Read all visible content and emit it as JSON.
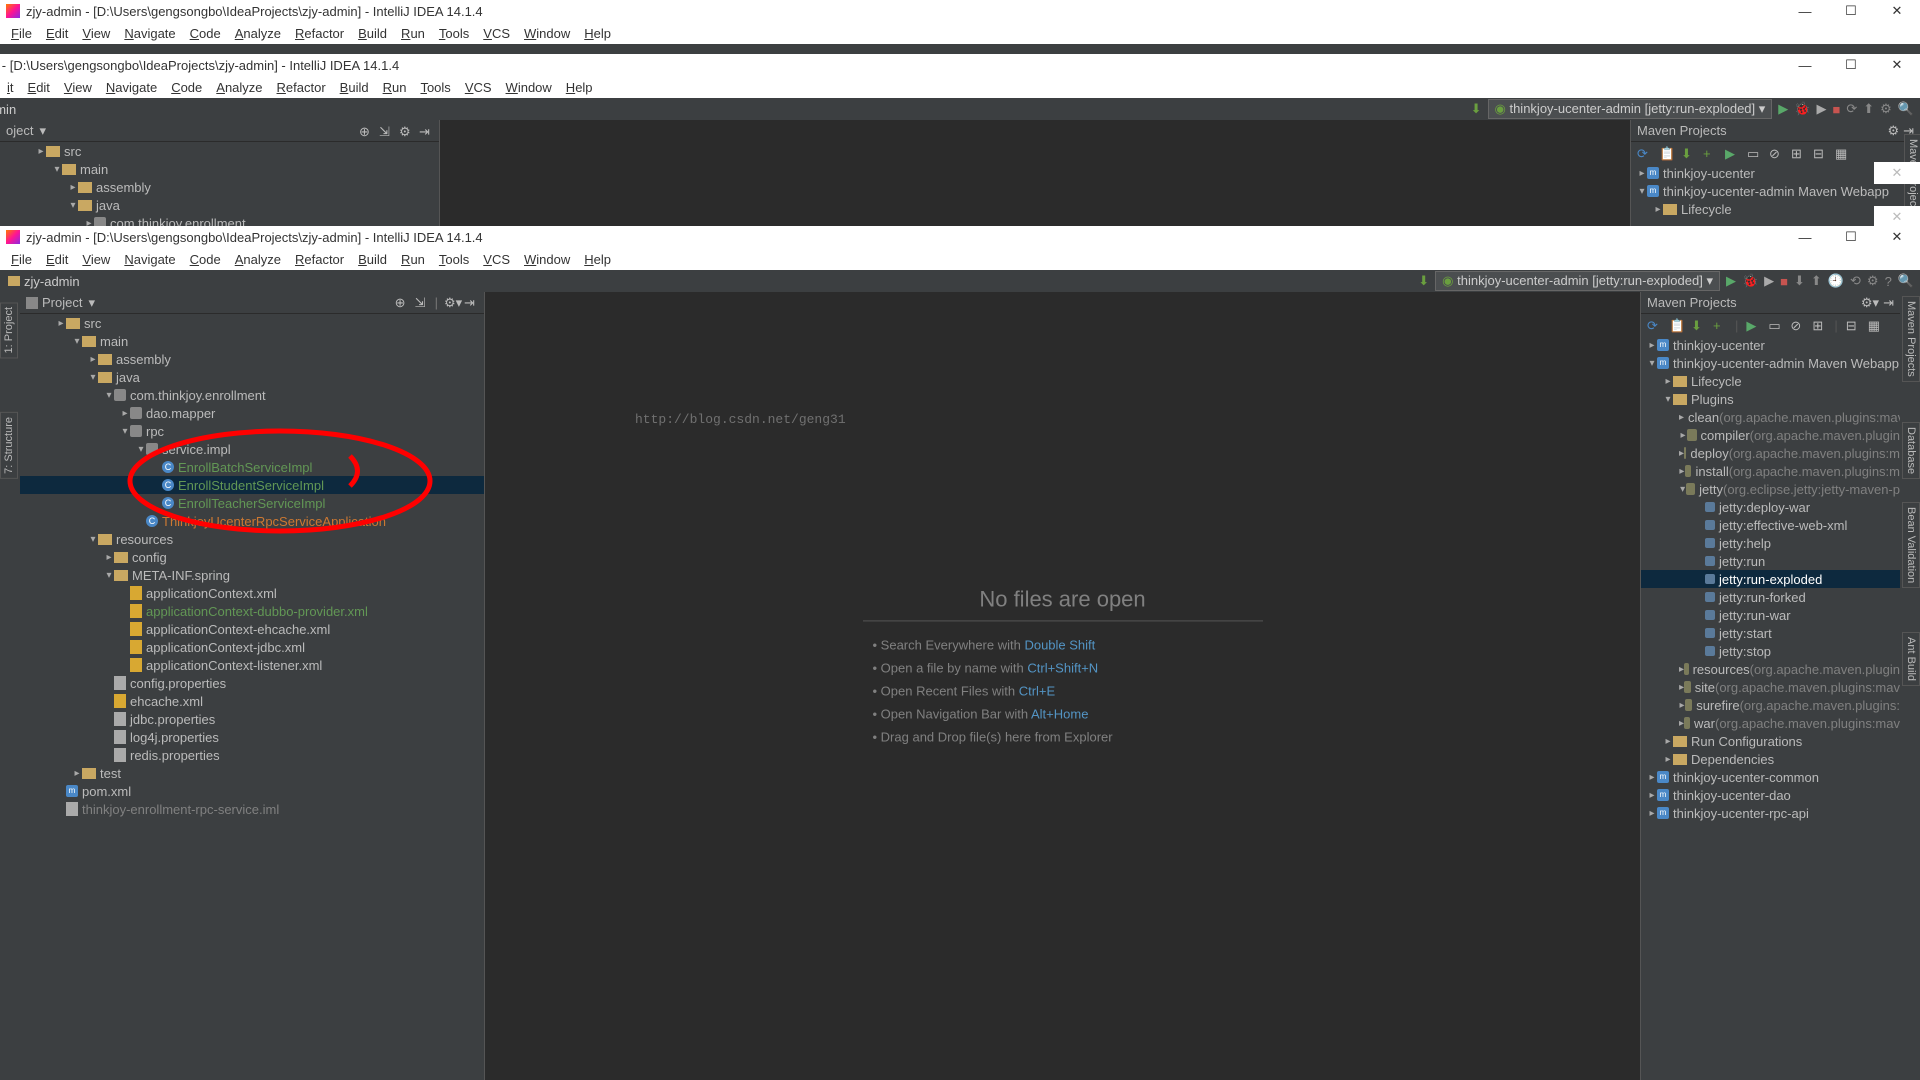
{
  "title": "zjy-admin - [D:\\Users\\gengsongbo\\IdeaProjects\\zjy-admin] - IntelliJ IDEA 14.1.4",
  "menu": [
    "File",
    "Edit",
    "View",
    "Navigate",
    "Code",
    "Analyze",
    "Refactor",
    "Build",
    "Run",
    "Tools",
    "VCS",
    "Window",
    "Help"
  ],
  "breadcrumb_root": "zjy-admin",
  "run_config": "thinkjoy-ucenter-admin [jetty:run-exploded]",
  "project_panel": "Project",
  "panel_icons": [
    "scroll",
    "collapse",
    "settings",
    "hide"
  ],
  "watermark_url": "http://blog.csdn.net/geng31",
  "no_files": "No files are open",
  "tips": [
    {
      "t": "Search Everywhere with ",
      "k": "Double Shift"
    },
    {
      "t": "Open a file by name with ",
      "k": "Ctrl+Shift+N"
    },
    {
      "t": "Open Recent Files with ",
      "k": "Ctrl+E"
    },
    {
      "t": "Open Navigation Bar with ",
      "k": "Alt+Home"
    },
    {
      "t": "Drag and Drop file(s) here from Explorer",
      "k": ""
    }
  ],
  "tree_w2": [
    {
      "d": 2,
      "a": "▸",
      "i": "fld",
      "t": "src"
    },
    {
      "d": 3,
      "a": "▾",
      "i": "fld",
      "t": "main"
    },
    {
      "d": 4,
      "a": "▸",
      "i": "fld",
      "t": "assembly"
    },
    {
      "d": 4,
      "a": "▾",
      "i": "fld",
      "t": "java"
    },
    {
      "d": 5,
      "a": "▸",
      "i": "pkg",
      "t": "com.thinkjoy.enrollment"
    }
  ],
  "tree_w3": [
    {
      "d": 2,
      "a": "▸",
      "i": "fld",
      "t": "src"
    },
    {
      "d": 3,
      "a": "▾",
      "i": "fld",
      "t": "main"
    },
    {
      "d": 4,
      "a": "▸",
      "i": "fld",
      "t": "assembly"
    },
    {
      "d": 4,
      "a": "▾",
      "i": "fld",
      "t": "java"
    },
    {
      "d": 5,
      "a": "▾",
      "i": "pkg",
      "t": "com.thinkjoy.enrollment"
    },
    {
      "d": 6,
      "a": "▸",
      "i": "pkg",
      "t": "dao.mapper"
    },
    {
      "d": 6,
      "a": "▾",
      "i": "pkg",
      "t": "rpc"
    },
    {
      "d": 7,
      "a": "▾",
      "i": "pkg",
      "t": "service.impl"
    },
    {
      "d": 8,
      "a": "",
      "i": "cls",
      "t": "EnrollBatchServiceImpl",
      "cls": "green-txt"
    },
    {
      "d": 8,
      "a": "",
      "i": "cls",
      "t": "EnrollStudentServiceImpl",
      "cls": "green-txt",
      "sel": true
    },
    {
      "d": 8,
      "a": "",
      "i": "cls",
      "t": "EnrollTeacherServiceImpl",
      "cls": "green-txt"
    },
    {
      "d": 7,
      "a": "",
      "i": "cls",
      "t": "ThinkjoyUcenterRpcServiceApplication",
      "cls": "orange-txt"
    },
    {
      "d": 4,
      "a": "▾",
      "i": "fld",
      "t": "resources"
    },
    {
      "d": 5,
      "a": "▸",
      "i": "fld",
      "t": "config"
    },
    {
      "d": 5,
      "a": "▾",
      "i": "fld",
      "t": "META-INF.spring"
    },
    {
      "d": 6,
      "a": "",
      "i": "xml",
      "t": "applicationContext.xml"
    },
    {
      "d": 6,
      "a": "",
      "i": "xml",
      "t": "applicationContext-dubbo-provider.xml",
      "cls": "green-txt"
    },
    {
      "d": 6,
      "a": "",
      "i": "xml",
      "t": "applicationContext-ehcache.xml"
    },
    {
      "d": 6,
      "a": "",
      "i": "xml",
      "t": "applicationContext-jdbc.xml"
    },
    {
      "d": 6,
      "a": "",
      "i": "xml",
      "t": "applicationContext-listener.xml"
    },
    {
      "d": 5,
      "a": "",
      "i": "file",
      "t": "config.properties"
    },
    {
      "d": 5,
      "a": "",
      "i": "xml",
      "t": "ehcache.xml"
    },
    {
      "d": 5,
      "a": "",
      "i": "file",
      "t": "jdbc.properties"
    },
    {
      "d": 5,
      "a": "",
      "i": "file",
      "t": "log4j.properties"
    },
    {
      "d": 5,
      "a": "",
      "i": "file",
      "t": "redis.properties"
    },
    {
      "d": 3,
      "a": "▸",
      "i": "fld",
      "t": "test"
    },
    {
      "d": 2,
      "a": "",
      "i": "m",
      "t": "pom.xml"
    },
    {
      "d": 2,
      "a": "",
      "i": "file",
      "t": "thinkjoy-enrollment-rpc-service.iml",
      "cls": "dim"
    }
  ],
  "maven_title": "Maven Projects",
  "maven_w2": [
    {
      "d": 0,
      "a": "▸",
      "i": "m",
      "t": "thinkjoy-ucenter"
    },
    {
      "d": 0,
      "a": "▾",
      "i": "m",
      "t": "thinkjoy-ucenter-admin Maven Webapp"
    },
    {
      "d": 1,
      "a": "▸",
      "i": "fld",
      "t": "Lifecycle"
    }
  ],
  "maven_w3": [
    {
      "d": 0,
      "a": "▸",
      "i": "m",
      "t": "thinkjoy-ucenter"
    },
    {
      "d": 0,
      "a": "▾",
      "i": "m",
      "t": "thinkjoy-ucenter-admin Maven Webapp"
    },
    {
      "d": 1,
      "a": "▸",
      "i": "fld",
      "t": "Lifecycle"
    },
    {
      "d": 1,
      "a": "▾",
      "i": "fld",
      "t": "Plugins"
    },
    {
      "d": 2,
      "a": "▸",
      "i": "g",
      "t": "clean",
      "x": "(org.apache.maven.plugins:mav"
    },
    {
      "d": 2,
      "a": "▸",
      "i": "g",
      "t": "compiler",
      "x": "(org.apache.maven.plugin"
    },
    {
      "d": 2,
      "a": "▸",
      "i": "g",
      "t": "deploy",
      "x": "(org.apache.maven.plugins:m"
    },
    {
      "d": 2,
      "a": "▸",
      "i": "g",
      "t": "install",
      "x": "(org.apache.maven.plugins:m"
    },
    {
      "d": 2,
      "a": "▾",
      "i": "g",
      "t": "jetty",
      "x": "(org.eclipse.jetty:jetty-maven-p"
    },
    {
      "d": 3,
      "a": "",
      "i": "goal",
      "t": "jetty:deploy-war"
    },
    {
      "d": 3,
      "a": "",
      "i": "goal",
      "t": "jetty:effective-web-xml"
    },
    {
      "d": 3,
      "a": "",
      "i": "goal",
      "t": "jetty:help"
    },
    {
      "d": 3,
      "a": "",
      "i": "goal",
      "t": "jetty:run"
    },
    {
      "d": 3,
      "a": "",
      "i": "goal",
      "t": "jetty:run-exploded",
      "sel": true
    },
    {
      "d": 3,
      "a": "",
      "i": "goal",
      "t": "jetty:run-forked"
    },
    {
      "d": 3,
      "a": "",
      "i": "goal",
      "t": "jetty:run-war"
    },
    {
      "d": 3,
      "a": "",
      "i": "goal",
      "t": "jetty:start"
    },
    {
      "d": 3,
      "a": "",
      "i": "goal",
      "t": "jetty:stop"
    },
    {
      "d": 2,
      "a": "▸",
      "i": "g",
      "t": "resources",
      "x": "(org.apache.maven.plugin"
    },
    {
      "d": 2,
      "a": "▸",
      "i": "g",
      "t": "site",
      "x": "(org.apache.maven.plugins:mav"
    },
    {
      "d": 2,
      "a": "▸",
      "i": "g",
      "t": "surefire",
      "x": "(org.apache.maven.plugins:"
    },
    {
      "d": 2,
      "a": "▸",
      "i": "g",
      "t": "war",
      "x": "(org.apache.maven.plugins:mav"
    },
    {
      "d": 1,
      "a": "▸",
      "i": "fld",
      "t": "Run Configurations"
    },
    {
      "d": 1,
      "a": "▸",
      "i": "fld",
      "t": "Dependencies"
    },
    {
      "d": 0,
      "a": "▸",
      "i": "m",
      "t": "thinkjoy-ucenter-common"
    },
    {
      "d": 0,
      "a": "▸",
      "i": "m",
      "t": "thinkjoy-ucenter-dao"
    },
    {
      "d": 0,
      "a": "▸",
      "i": "m",
      "t": "thinkjoy-ucenter-rpc-api"
    }
  ],
  "side_tabs_right": [
    "Maven Projects",
    "Database",
    "Bean Validation",
    "Ant Build"
  ],
  "side_tabs_left": [
    "1: Project",
    "7: Structure"
  ],
  "toolbar_icons": [
    "build",
    "run",
    "debug",
    "coverage",
    "stop",
    "vcs-update",
    "vcs-commit",
    "vcs-history",
    "vcs-revert",
    "settings",
    "help",
    "search"
  ]
}
